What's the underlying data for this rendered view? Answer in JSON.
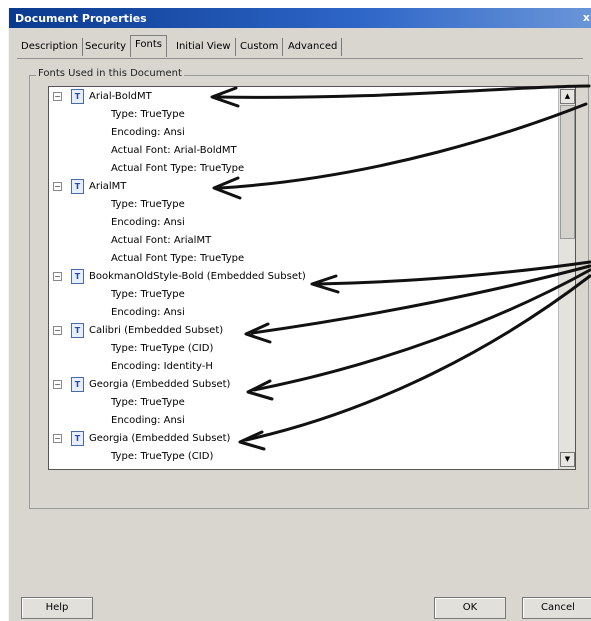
{
  "window": {
    "title": "Document Properties",
    "close_glyph": "x"
  },
  "tabs": [
    {
      "label": "Description",
      "active": false
    },
    {
      "label": "Security",
      "active": false
    },
    {
      "label": "Fonts",
      "active": true
    },
    {
      "label": "Initial View",
      "active": false
    },
    {
      "label": "Custom",
      "active": false
    },
    {
      "label": "Advanced",
      "active": false
    }
  ],
  "group_title": "Fonts Used in this Document",
  "fonts": [
    {
      "name": "Arial-BoldMT",
      "props": [
        "Type: TrueType",
        "Encoding: Ansi",
        "Actual Font: Arial-BoldMT",
        "Actual Font Type: TrueType"
      ]
    },
    {
      "name": "ArialMT",
      "props": [
        "Type: TrueType",
        "Encoding: Ansi",
        "Actual Font: ArialMT",
        "Actual Font Type: TrueType"
      ]
    },
    {
      "name": "BookmanOldStyle-Bold (Embedded Subset)",
      "props": [
        "Type: TrueType",
        "Encoding: Ansi"
      ]
    },
    {
      "name": "Calibri (Embedded Subset)",
      "props": [
        "Type: TrueType (CID)",
        "Encoding: Identity-H"
      ]
    },
    {
      "name": "Georgia (Embedded Subset)",
      "props": [
        "Type: TrueType",
        "Encoding: Ansi"
      ]
    },
    {
      "name": "Georgia (Embedded Subset)",
      "props": [
        "Type: TrueType (CID)"
      ]
    }
  ],
  "buttons": {
    "help": "Help",
    "ok": "OK",
    "cancel": "Cancel"
  },
  "colors": {
    "titlebar": "#0a3a8e",
    "dialog_bg": "#d8d6cf",
    "arrow_ink": "#111111"
  }
}
